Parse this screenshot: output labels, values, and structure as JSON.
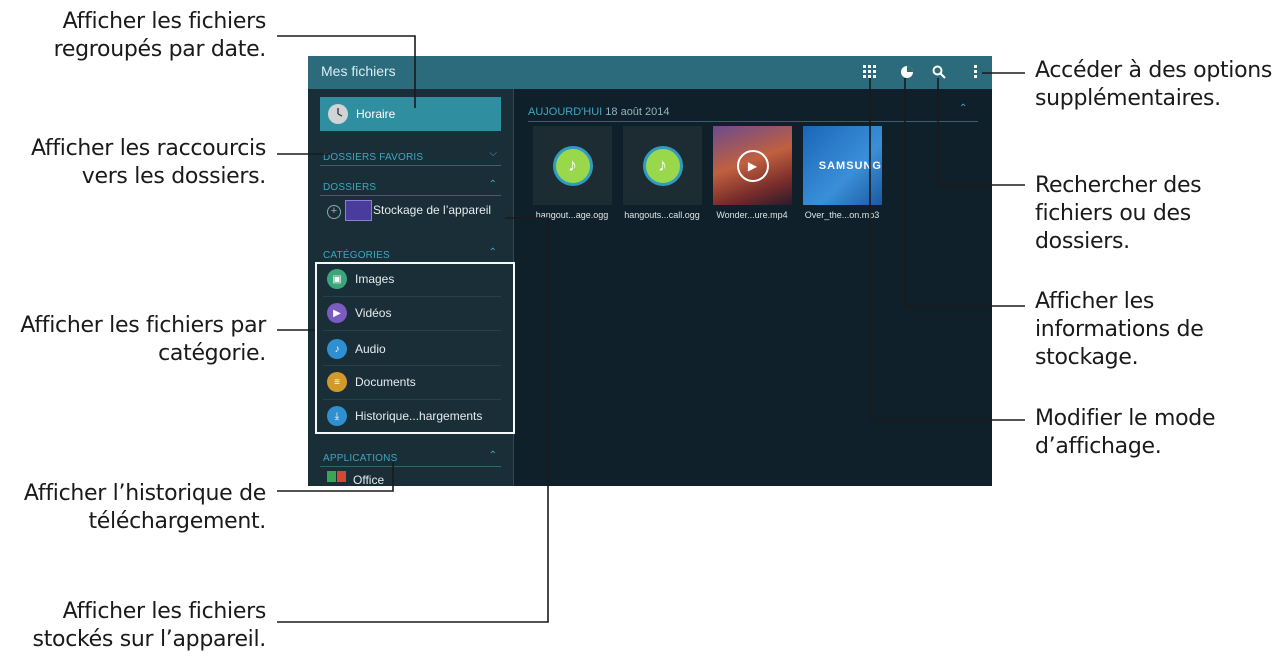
{
  "annotations": {
    "date_view": [
      "Afficher les fichiers",
      "regroupés par date."
    ],
    "shortcuts": [
      "Afficher les raccourcis",
      "vers les dossiers."
    ],
    "by_category": [
      "Afficher les fichiers par",
      "catégorie."
    ],
    "download_history": [
      "Afficher l’historique de",
      "téléchargement."
    ],
    "device_files": [
      "Afficher les fichiers",
      "stockés sur l’appareil."
    ],
    "more_options": [
      "Accéder à des options",
      "supplémentaires."
    ],
    "search": [
      "Rechercher des",
      "fichiers ou des",
      "dossiers."
    ],
    "storage_info": [
      "Afficher les",
      "informations de",
      "stockage."
    ],
    "view_mode": [
      "Modifier le mode",
      "d’affichage."
    ]
  },
  "app": {
    "title": "Mes fichiers",
    "accent": "#2b6b7b",
    "toolbar_icons": [
      "view-mode-grid-icon",
      "storage-pie-icon",
      "search-icon",
      "more-options-icon"
    ]
  },
  "sidebar": {
    "selected": "Horaire",
    "favorites_header": "DOSSIERS FAVORIS",
    "folders_header": "DOSSIERS",
    "device_storage": "Stockage de l’appareil",
    "categories_header": "CATÉGORIES",
    "categories": [
      {
        "label": "Images",
        "color": "#3aa67a"
      },
      {
        "label": "Vidéos",
        "color": "#7a5bbf"
      },
      {
        "label": "Audio",
        "color": "#2f8fd0"
      },
      {
        "label": "Documents",
        "color": "#d19a2a"
      },
      {
        "label": "Historique...hargements",
        "color": "#2f8fd0"
      }
    ],
    "applications_header": "APPLICATIONS",
    "applications": [
      {
        "label": "Office"
      }
    ]
  },
  "main": {
    "section_header": "AUJOURD'HUI",
    "section_date": "18 août 2014",
    "files": [
      {
        "name": "hangout...age.ogg",
        "kind": "audio"
      },
      {
        "name": "hangouts...call.ogg",
        "kind": "audio"
      },
      {
        "name": "Wonder...ure.mp4",
        "kind": "video"
      },
      {
        "name": "Over_the...on.mp3",
        "kind": "samsung"
      }
    ],
    "samsung_label": "SAMSUNG"
  }
}
